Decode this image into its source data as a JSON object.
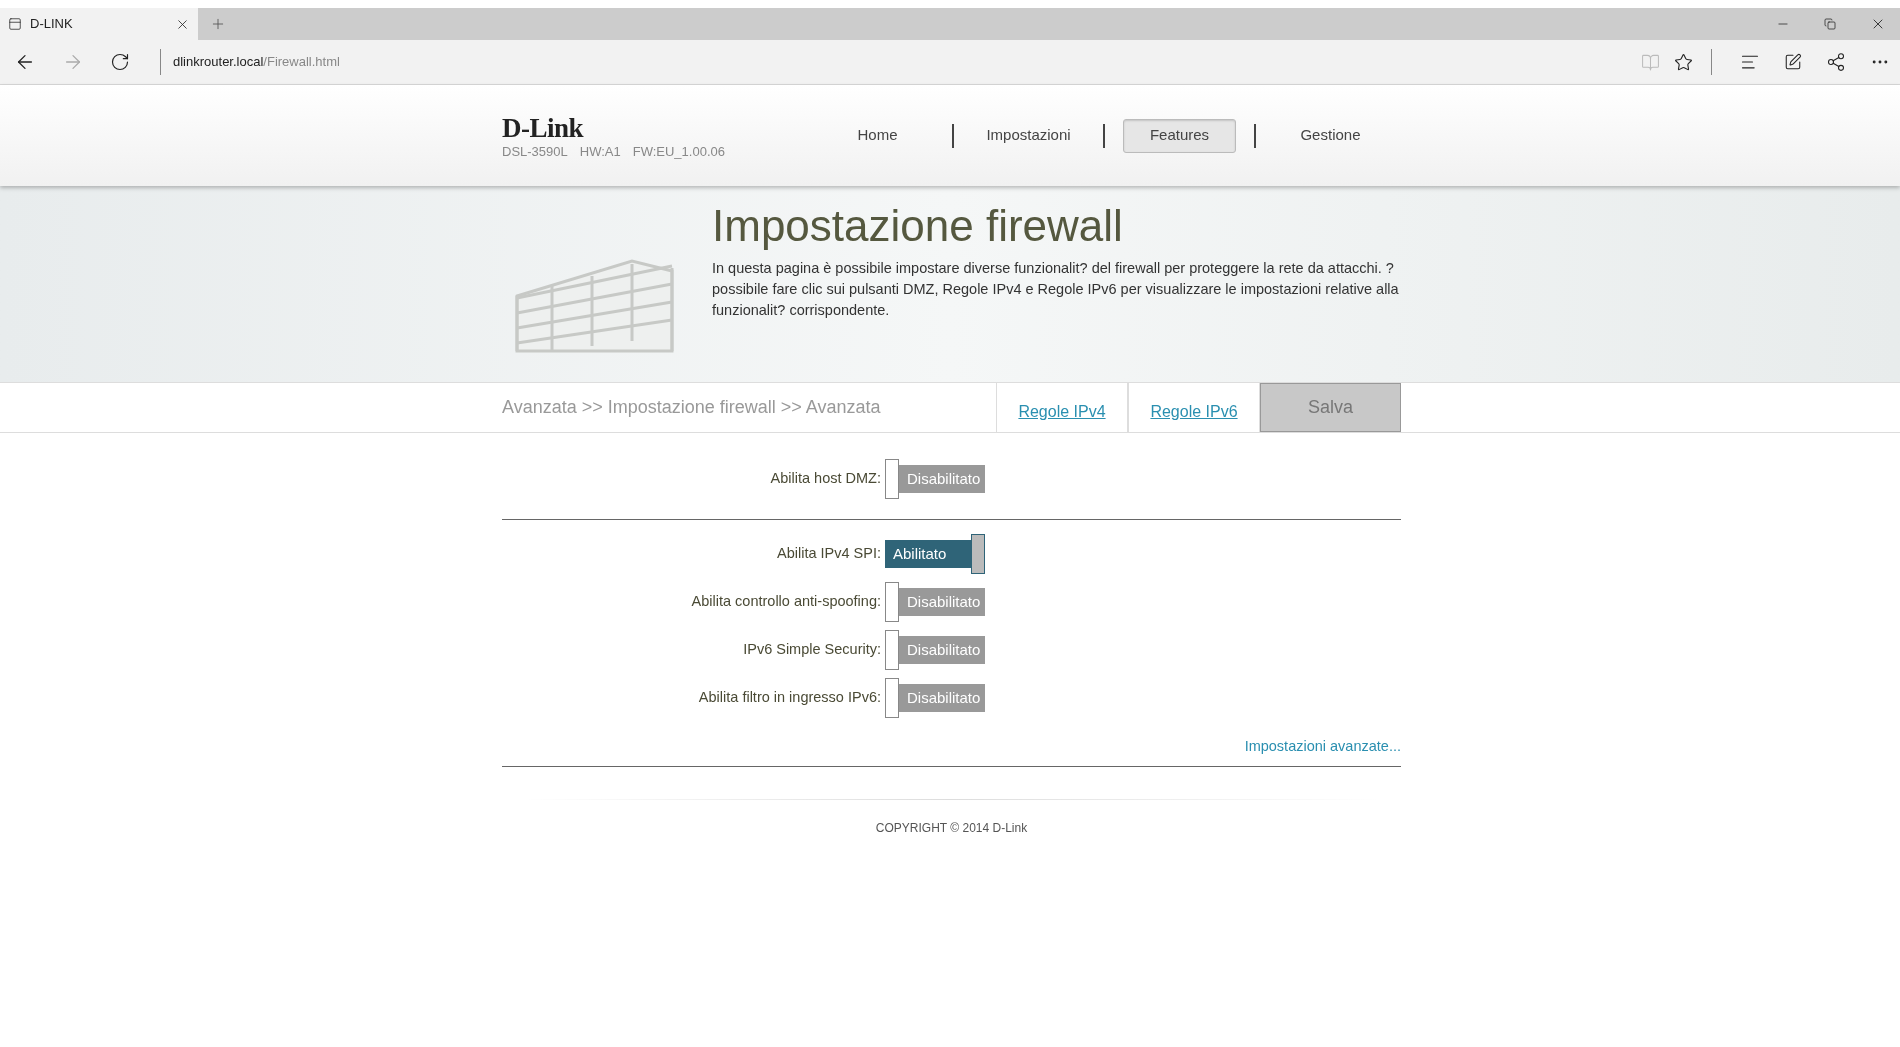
{
  "browser": {
    "tab_title": "D-LINK",
    "address_host": "dlinkrouter.local",
    "address_path": "/Firewall.html"
  },
  "header": {
    "logo": "D-Link",
    "model": "DSL-3590L",
    "hw": "HW:A1",
    "fw": "FW:EU_1.00.06",
    "nav": [
      {
        "label": "Home",
        "selected": false
      },
      {
        "label": "Impostazioni",
        "selected": false
      },
      {
        "label": "Features",
        "selected": true
      },
      {
        "label": "Gestione",
        "selected": false
      }
    ]
  },
  "banner": {
    "title": "Impostazione firewall",
    "description": "In questa pagina è possibile impostare diverse funzionalit? del firewall per proteggere la rete da attacchi. ? possibile fare clic sui pulsanti DMZ, Regole IPv4 e Regole IPv6 per visualizzare le impostazioni relative alla funzionalit? corrispondente."
  },
  "breadcrumb": "Avanzata >> Impostazione firewall >> Avanzata",
  "actions": [
    {
      "label": "Regole IPv4",
      "kind": "link"
    },
    {
      "label": "Regole IPv6",
      "kind": "link"
    },
    {
      "label": "Salva",
      "kind": "save"
    }
  ],
  "settings": [
    {
      "label": "Abilita host DMZ:",
      "on": false,
      "value": "Disabilitato"
    },
    {
      "label": "Abilita IPv4 SPI:",
      "on": true,
      "value": "Abilitato"
    },
    {
      "label": "Abilita controllo anti-spoofing:",
      "on": false,
      "value": "Disabilitato"
    },
    {
      "label": "IPv6 Simple Security:",
      "on": false,
      "value": "Disabilitato"
    },
    {
      "label": "Abilita filtro in ingresso IPv6:",
      "on": false,
      "value": "Disabilitato"
    }
  ],
  "advanced_link": "Impostazioni avanzate...",
  "footer": "COPYRIGHT © 2014 D-Link"
}
